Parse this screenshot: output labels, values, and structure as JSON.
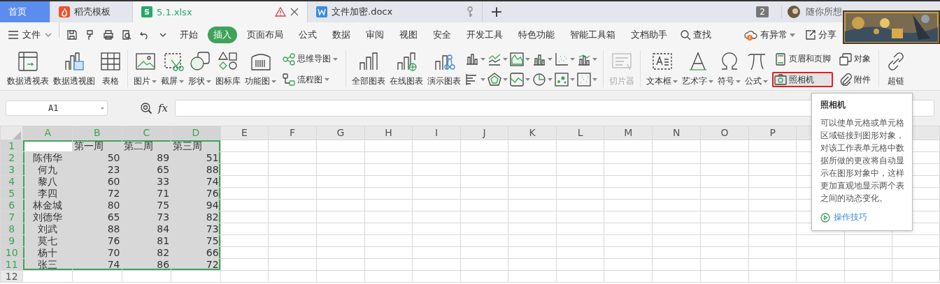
{
  "tabs": [
    {
      "label": "首页",
      "kind": "home",
      "selected": false,
      "warning": false,
      "closable": false
    },
    {
      "label": "稻壳模板",
      "kind": "template",
      "selected": false,
      "warning": false,
      "closable": false
    },
    {
      "label": "5.1.xlsx",
      "kind": "sheet",
      "selected": true,
      "warning": true,
      "closable": true
    },
    {
      "label": "文件加密.docx",
      "kind": "doc",
      "selected": false,
      "warning": false,
      "closable": false
    }
  ],
  "new_tab": "+",
  "window_count": "2",
  "user_name": "随你所想",
  "menu": {
    "file": "文件",
    "ribbon_tabs": [
      {
        "label": "开始",
        "selected": false
      },
      {
        "label": "插入",
        "selected": true
      },
      {
        "label": "页面布局",
        "selected": false
      },
      {
        "label": "公式",
        "selected": false
      },
      {
        "label": "数据",
        "selected": false
      },
      {
        "label": "审阅",
        "selected": false
      },
      {
        "label": "视图",
        "selected": false
      },
      {
        "label": "安全",
        "selected": false
      },
      {
        "label": "开发工具",
        "selected": false
      },
      {
        "label": "特色功能",
        "selected": false
      },
      {
        "label": "智能工具箱",
        "selected": false
      },
      {
        "label": "文档助手",
        "selected": false
      }
    ],
    "search": "查找",
    "status": "有异常",
    "share": "分享"
  },
  "ribbon": {
    "groups": [
      [
        {
          "label": "数据透视表",
          "kind": "large",
          "dropdown": false,
          "disabled": false,
          "highlighted": false
        },
        {
          "label": "数据透视图",
          "kind": "large",
          "dropdown": false,
          "disabled": false,
          "highlighted": false
        },
        {
          "label": "表格",
          "kind": "large",
          "dropdown": false,
          "disabled": false,
          "highlighted": false
        }
      ],
      [
        {
          "label": "图片",
          "kind": "large",
          "dropdown": true,
          "disabled": false,
          "highlighted": false
        },
        {
          "label": "截屏",
          "kind": "large",
          "dropdown": true,
          "disabled": false,
          "highlighted": false
        },
        {
          "label": "形状",
          "kind": "large",
          "dropdown": true,
          "disabled": false,
          "highlighted": false
        },
        {
          "label": "图标库",
          "kind": "large",
          "dropdown": false,
          "disabled": false,
          "highlighted": false
        },
        {
          "label": "功能图",
          "kind": "large",
          "dropdown": true,
          "disabled": false,
          "highlighted": false
        },
        {
          "label": "思维导图",
          "kind": "small",
          "dropdown": true,
          "disabled": false,
          "highlighted": false
        },
        {
          "label": "流程图",
          "kind": "small",
          "dropdown": true,
          "disabled": false,
          "highlighted": false
        }
      ],
      [
        {
          "label": "全部图表",
          "kind": "large",
          "dropdown": false,
          "disabled": false,
          "highlighted": false
        },
        {
          "label": "在线图表",
          "kind": "large",
          "dropdown": false,
          "disabled": false,
          "highlighted": false
        },
        {
          "label": "演示图表",
          "kind": "large",
          "dropdown": false,
          "disabled": false,
          "highlighted": false
        },
        {
          "kind": "icon",
          "dropdown": true,
          "disabled": false,
          "highlighted": false
        },
        {
          "kind": "icon",
          "dropdown": true,
          "disabled": false,
          "highlighted": false
        },
        {
          "kind": "icon",
          "dropdown": true,
          "disabled": false,
          "highlighted": false
        },
        {
          "kind": "icon",
          "dropdown": true,
          "disabled": false,
          "highlighted": false
        },
        {
          "kind": "icon",
          "dropdown": true,
          "disabled": false,
          "highlighted": false
        },
        {
          "kind": "icon",
          "dropdown": true,
          "disabled": false,
          "highlighted": false
        },
        {
          "kind": "icon",
          "dropdown": true,
          "disabled": false,
          "highlighted": false
        },
        {
          "kind": "icon",
          "dropdown": true,
          "disabled": false,
          "highlighted": false
        },
        {
          "kind": "icon",
          "dropdown": true,
          "disabled": false,
          "highlighted": false
        },
        {
          "kind": "icon",
          "dropdown": true,
          "disabled": false,
          "highlighted": false
        },
        {
          "kind": "icon",
          "dropdown": true,
          "disabled": false,
          "highlighted": false
        },
        {
          "kind": "icon",
          "dropdown": true,
          "disabled": false,
          "highlighted": false
        }
      ],
      [
        {
          "label": "切片器",
          "kind": "large",
          "dropdown": false,
          "disabled": true,
          "highlighted": false
        }
      ],
      [
        {
          "label": "文本框",
          "kind": "large",
          "dropdown": true,
          "disabled": false,
          "highlighted": false
        },
        {
          "label": "艺术字",
          "kind": "large",
          "dropdown": true,
          "disabled": false,
          "highlighted": false
        },
        {
          "label": "符号",
          "kind": "large",
          "dropdown": true,
          "disabled": false,
          "highlighted": false
        },
        {
          "label": "公式",
          "kind": "large",
          "dropdown": true,
          "disabled": false,
          "highlighted": false
        },
        {
          "label": "页眉和页脚",
          "kind": "small",
          "dropdown": false,
          "disabled": false,
          "highlighted": false
        },
        {
          "label": "照相机",
          "kind": "small",
          "dropdown": false,
          "disabled": false,
          "highlighted": true
        },
        {
          "label": "对象",
          "kind": "small",
          "dropdown": false,
          "disabled": false,
          "highlighted": false
        },
        {
          "label": "附件",
          "kind": "small",
          "dropdown": false,
          "disabled": false,
          "highlighted": false
        }
      ],
      [
        {
          "label": "超链",
          "kind": "large",
          "dropdown": false,
          "disabled": false,
          "highlighted": false
        }
      ]
    ]
  },
  "sheet": {
    "name_box": "A1",
    "fx": "fx",
    "columns": [
      {
        "label": "A",
        "selected": true
      },
      {
        "label": "B",
        "selected": true
      },
      {
        "label": "C",
        "selected": true
      },
      {
        "label": "D",
        "selected": true
      },
      {
        "label": "E",
        "selected": false
      },
      {
        "label": "F",
        "selected": false
      },
      {
        "label": "G",
        "selected": false
      },
      {
        "label": "H",
        "selected": false
      },
      {
        "label": "I",
        "selected": false
      },
      {
        "label": "J",
        "selected": false
      },
      {
        "label": "K",
        "selected": false
      },
      {
        "label": "L",
        "selected": false
      },
      {
        "label": "M",
        "selected": false
      },
      {
        "label": "N",
        "selected": false
      },
      {
        "label": "O",
        "selected": false
      },
      {
        "label": "P",
        "selected": false
      }
    ],
    "rows": [
      {
        "label": "1",
        "selected": true,
        "cells": [
          {
            "kind": "active"
          },
          {
            "text": "第一周",
            "kind": "header"
          },
          {
            "text": "第二周",
            "kind": "header"
          },
          {
            "text": "第三周",
            "kind": "header"
          }
        ]
      },
      {
        "label": "2",
        "selected": true,
        "cells": [
          {
            "text": "陈伟华",
            "kind": "name"
          },
          {
            "text": "50",
            "kind": "number"
          },
          {
            "text": "89",
            "kind": "number"
          },
          {
            "text": "51",
            "kind": "number"
          }
        ]
      },
      {
        "label": "3",
        "selected": true,
        "cells": [
          {
            "text": "何九",
            "kind": "name"
          },
          {
            "text": "23",
            "kind": "number"
          },
          {
            "text": "65",
            "kind": "number"
          },
          {
            "text": "88",
            "kind": "number"
          }
        ]
      },
      {
        "label": "4",
        "selected": true,
        "cells": [
          {
            "text": "黎八",
            "kind": "name"
          },
          {
            "text": "60",
            "kind": "number"
          },
          {
            "text": "33",
            "kind": "number"
          },
          {
            "text": "74",
            "kind": "number"
          }
        ]
      },
      {
        "label": "5",
        "selected": true,
        "cells": [
          {
            "text": "李四",
            "kind": "name"
          },
          {
            "text": "72",
            "kind": "number"
          },
          {
            "text": "71",
            "kind": "number"
          },
          {
            "text": "76",
            "kind": "number"
          }
        ]
      },
      {
        "label": "6",
        "selected": true,
        "cells": [
          {
            "text": "林金城",
            "kind": "name"
          },
          {
            "text": "80",
            "kind": "number"
          },
          {
            "text": "75",
            "kind": "number"
          },
          {
            "text": "94",
            "kind": "number"
          }
        ]
      },
      {
        "label": "7",
        "selected": true,
        "cells": [
          {
            "text": "刘德华",
            "kind": "name"
          },
          {
            "text": "65",
            "kind": "number"
          },
          {
            "text": "73",
            "kind": "number"
          },
          {
            "text": "82",
            "kind": "number"
          }
        ]
      },
      {
        "label": "8",
        "selected": true,
        "cells": [
          {
            "text": "刘武",
            "kind": "name"
          },
          {
            "text": "88",
            "kind": "number"
          },
          {
            "text": "84",
            "kind": "number"
          },
          {
            "text": "73",
            "kind": "number"
          }
        ]
      },
      {
        "label": "9",
        "selected": true,
        "cells": [
          {
            "text": "莫七",
            "kind": "name"
          },
          {
            "text": "76",
            "kind": "number"
          },
          {
            "text": "81",
            "kind": "number"
          },
          {
            "text": "75",
            "kind": "number"
          }
        ]
      },
      {
        "label": "10",
        "selected": true,
        "cells": [
          {
            "text": "杨十",
            "kind": "name"
          },
          {
            "text": "70",
            "kind": "number"
          },
          {
            "text": "82",
            "kind": "number"
          },
          {
            "text": "66",
            "kind": "number"
          }
        ]
      },
      {
        "label": "11",
        "selected": true,
        "cells": [
          {
            "text": "张三",
            "kind": "name"
          },
          {
            "text": "74",
            "kind": "number"
          },
          {
            "text": "86",
            "kind": "number"
          },
          {
            "text": "72",
            "kind": "number"
          }
        ]
      },
      {
        "label": "12",
        "selected": false,
        "cells": []
      }
    ]
  },
  "tooltip": {
    "title": "照相机",
    "body": "可以使单元格或单元格区域链接到图形对象，对该工作表单元格中数据所做的更改将自动显示在图形对象中，这样更加直观地显示两个表之间的动态变化。",
    "link": "操作技巧"
  }
}
